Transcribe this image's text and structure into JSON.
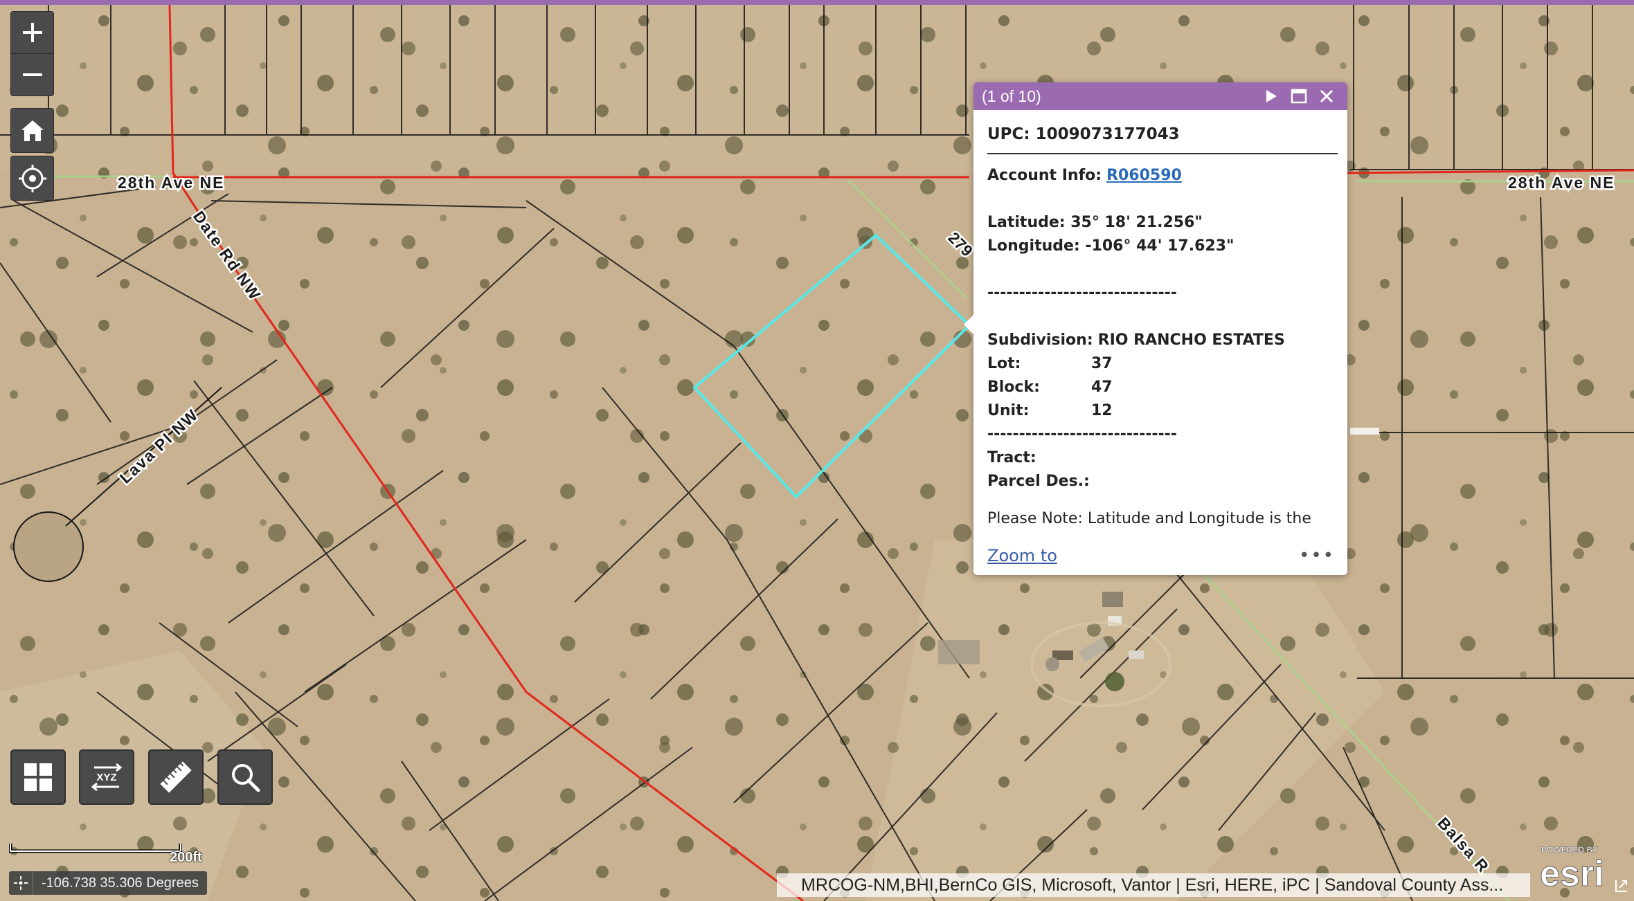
{
  "map": {
    "roads": {
      "ave_28_left": "28th Ave NE",
      "ave_28_right": "28th Ave NE",
      "date_rd": "Date Rd NW",
      "lava_pl": "Lava Pl NW",
      "st_279": "279",
      "balsa_rd": "Balsa R"
    },
    "colors": {
      "accent": "#9b6bb1",
      "parcel_highlight": "#56e8e8",
      "road_red": "#e2261b",
      "road_green": "#a8d48a",
      "parcel_lines": "#151515"
    }
  },
  "controls": {
    "zoom_in_icon": "plus-icon",
    "zoom_out_icon": "minus-icon",
    "home_icon": "home-icon",
    "locate_icon": "locate-icon"
  },
  "toolbar": {
    "basemap_icon": "grid-icon",
    "coordinate_label": "XYZ",
    "measure_icon": "ruler-icon",
    "search_icon": "search-icon"
  },
  "scale": {
    "label": "200ft"
  },
  "coordinates": {
    "value": "-106.738 35.306 Degrees"
  },
  "attribution": {
    "text": "MRCOG-NM,BHI,BernCo GIS, Microsoft, Vantor | Esri, HERE, iPC | Sandoval County Ass..."
  },
  "esri": {
    "powered_by": "POWERED BY",
    "logo": "esri"
  },
  "popup": {
    "count": "(1 of 10)",
    "upc": "UPC: 1009073177043",
    "account_label": "Account Info:",
    "account_value": "R060590",
    "latitude": "Latitude: 35° 18' 21.256\"",
    "longitude": "Longitude: -106° 44' 17.623\"",
    "separator": "------------------------------",
    "subdivision_label": "Subdivision:",
    "subdivision_value": "RIO RANCHO ESTATES",
    "lot_label": "Lot:",
    "lot_value": "37",
    "block_label": "Block:",
    "block_value": "47",
    "unit_label": "Unit:",
    "unit_value": "12",
    "tract_label": "Tract:",
    "parcel_des_label": "Parcel Des.:",
    "note": "Please Note: Latitude and Longitude is the approximate center of the parcel shown",
    "zoom_to": "Zoom to",
    "more": "•••"
  }
}
